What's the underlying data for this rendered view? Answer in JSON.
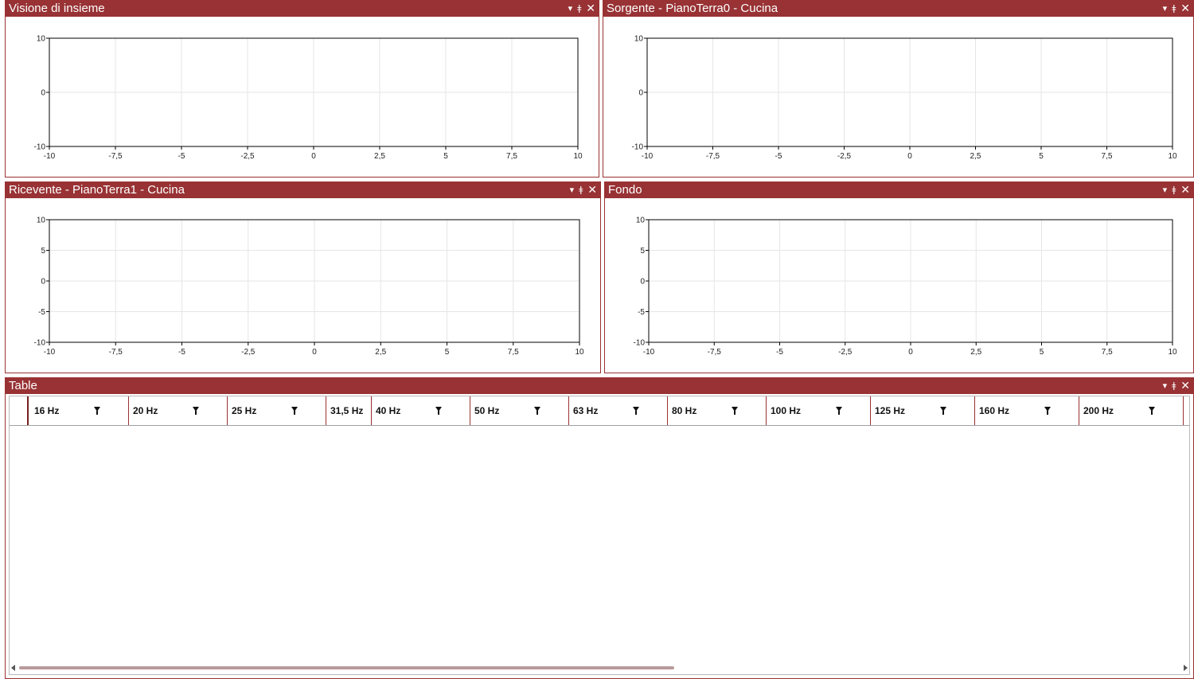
{
  "panels": [
    {
      "title": "Visione di insieme",
      "xticks": [
        "-10",
        "-7,5",
        "-5",
        "-2,5",
        "0",
        "2,5",
        "5",
        "7,5",
        "10"
      ],
      "yticks": [
        "10",
        "0",
        "-10"
      ],
      "xlim": [
        -10,
        10
      ],
      "ylim": [
        -10,
        10
      ]
    },
    {
      "title": "Sorgente - PianoTerra0 - Cucina",
      "xticks": [
        "-10",
        "-7,5",
        "-5",
        "-2,5",
        "0",
        "2,5",
        "5",
        "7,5",
        "10"
      ],
      "yticks": [
        "10",
        "0",
        "-10"
      ],
      "xlim": [
        -10,
        10
      ],
      "ylim": [
        -10,
        10
      ]
    },
    {
      "title": "Ricevente - PianoTerra1 - Cucina",
      "xticks": [
        "-10",
        "-7,5",
        "-5",
        "-2,5",
        "0",
        "2,5",
        "5",
        "7,5",
        "10"
      ],
      "yticks": [
        "10",
        "5",
        "0",
        "-5",
        "-10"
      ],
      "xlim": [
        -10,
        10
      ],
      "ylim": [
        -10,
        10
      ]
    },
    {
      "title": "Fondo",
      "xticks": [
        "-10",
        "-7,5",
        "-5",
        "-2,5",
        "0",
        "2,5",
        "5",
        "7,5",
        "10"
      ],
      "yticks": [
        "10",
        "5",
        "0",
        "-5",
        "-10"
      ],
      "xlim": [
        -10,
        10
      ],
      "ylim": [
        -10,
        10
      ]
    }
  ],
  "panel_buttons": {
    "dropdown": "▾",
    "pin": "📌",
    "close": "✕"
  },
  "table": {
    "title": "Table",
    "columns": [
      "16 Hz",
      "20 Hz",
      "25 Hz",
      "31,5 Hz",
      "40 Hz",
      "50 Hz",
      "63 Hz",
      "80 Hz",
      "100 Hz",
      "125 Hz",
      "160 Hz",
      "200 Hz"
    ]
  },
  "colors": {
    "accent": "#983234",
    "grid": "#e6e6e6"
  }
}
